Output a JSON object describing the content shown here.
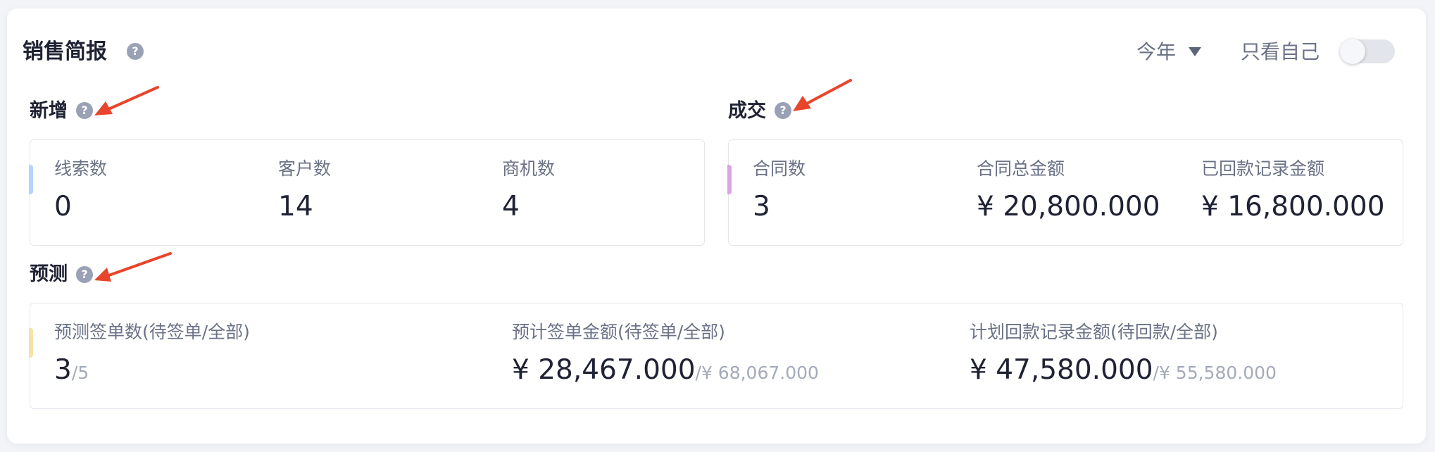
{
  "header": {
    "title": "销售简报",
    "help_icon_glyph": "?",
    "period": "今年",
    "only_me_label": "只看自己",
    "only_me_enabled": false
  },
  "sections": {
    "new": {
      "title": "新增",
      "accent_color": "#b6d3fb",
      "stats": [
        {
          "label": "线索数",
          "value": "0"
        },
        {
          "label": "客户数",
          "value": "14"
        },
        {
          "label": "商机数",
          "value": "4"
        }
      ]
    },
    "deal": {
      "title": "成交",
      "accent_color": "#d9a5e2",
      "stats": [
        {
          "label": "合同数",
          "value": "3"
        },
        {
          "label": "合同总金额",
          "value": "¥ 20,800.000"
        },
        {
          "label": "已回款记录金额",
          "value": "¥ 16,800.000"
        }
      ]
    },
    "forecast": {
      "title": "预测",
      "accent_color": "#f9e0a4",
      "stats": [
        {
          "label": "预测签单数(待签单/全部)",
          "value": "3",
          "total": "/5"
        },
        {
          "label": "预计签单金额(待签单/全部)",
          "value": "¥ 28,467.000",
          "total": "/¥ 68,067.000"
        },
        {
          "label": "计划回款记录金额(待回款/全部)",
          "value": "¥ 47,580.000",
          "total": "/¥ 55,580.000"
        }
      ]
    }
  },
  "annotation_arrow_color": "#e8452c"
}
